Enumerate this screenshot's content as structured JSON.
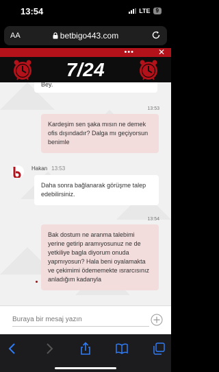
{
  "status_bar": {
    "time": "13:54",
    "network": "LTE",
    "battery": "9"
  },
  "browser": {
    "aa_label": "AA",
    "url": "betbigo443.com"
  },
  "header": {
    "menu_label": "•••",
    "close_label": "✕",
    "brand": "7/24"
  },
  "chat": {
    "partial_bubble_text": "Bey.",
    "messages": [
      {
        "type": "outgoing",
        "time": "13:53",
        "text": "Kardeşim sen şaka mısın ne demek ofis dışındadır? Dalga mı geçiyorsun benimle"
      },
      {
        "type": "incoming",
        "sender": "Hakan",
        "time": "13:53",
        "text": "Daha sonra bağlanarak görüşme talep edebilirsiniz."
      },
      {
        "type": "outgoing",
        "time": "13:54",
        "text": "Bak dostum ne aranma talebimi yerine getirip aramıyosunuz ne de yetkiliye bagla diyorum onuda yapmıyosun? Hala beni oyalamakta ve çekimimi ödememekte ısrarcısınız anladığım kadanyla"
      }
    ]
  },
  "composer": {
    "placeholder": "Buraya bir mesaj yazın"
  },
  "colors": {
    "brand_red": "#b3121b",
    "outgoing_bubble": "#f2dcdc",
    "header_black": "#0d0d0d"
  },
  "icons": [
    "lock-icon",
    "reload-icon",
    "clock-icon",
    "avatar-logo-icon",
    "add-icon",
    "back-icon",
    "forward-icon",
    "share-icon",
    "bookmarks-icon",
    "tabs-icon"
  ]
}
